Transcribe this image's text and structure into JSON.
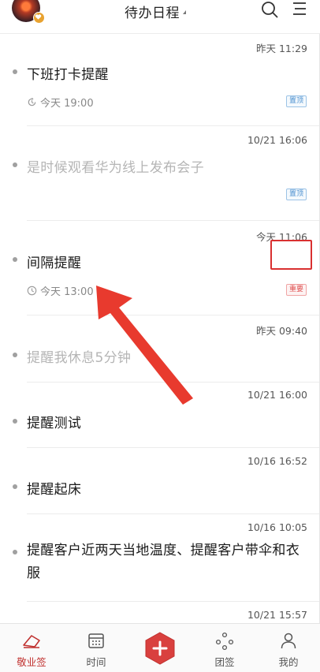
{
  "header": {
    "title": "待办日程",
    "avatar_icon": "user-avatar",
    "badge_icon": "heart-icon",
    "search_icon": "search-icon",
    "menu_icon": "menu-icon"
  },
  "items": [
    {
      "time": "昨天  11:29",
      "text": "下班打卡提醒",
      "muted": false,
      "meta": "今天 19:00",
      "meta_icon": "repeat-alarm-icon",
      "tag": "置顶"
    },
    {
      "time": "10/21 16:06",
      "text": "是时候观看华为线上发布会子",
      "muted": true,
      "tag": "置顶"
    },
    {
      "time": "今天  11:06",
      "text": "间隔提醒",
      "muted": false,
      "meta": "今天 13:00",
      "meta_icon": "clock-icon",
      "tag": "重要"
    },
    {
      "time": "昨天  09:40",
      "text": "提醒我休息5分钟",
      "muted": true
    },
    {
      "time": "10/21 16:00",
      "text": "提醒测试",
      "muted": false
    },
    {
      "time": "10/16 16:52",
      "text": "提醒起床",
      "muted": false
    },
    {
      "time": "10/16 10:05",
      "text": "提醒客户近两天当地温度、提醒客户带伞和衣服",
      "muted": false
    },
    {
      "time": "10/21 15:57"
    }
  ],
  "nav": {
    "items": [
      "敬业签",
      "时间",
      "团签",
      "我的"
    ],
    "active": "敬业签",
    "add_icon": "plus-icon"
  },
  "colors": {
    "accent": "#c0312f",
    "pin_tag": "#4a8fcf",
    "important_tag": "#e05050",
    "annotation_red": "#d93030"
  }
}
